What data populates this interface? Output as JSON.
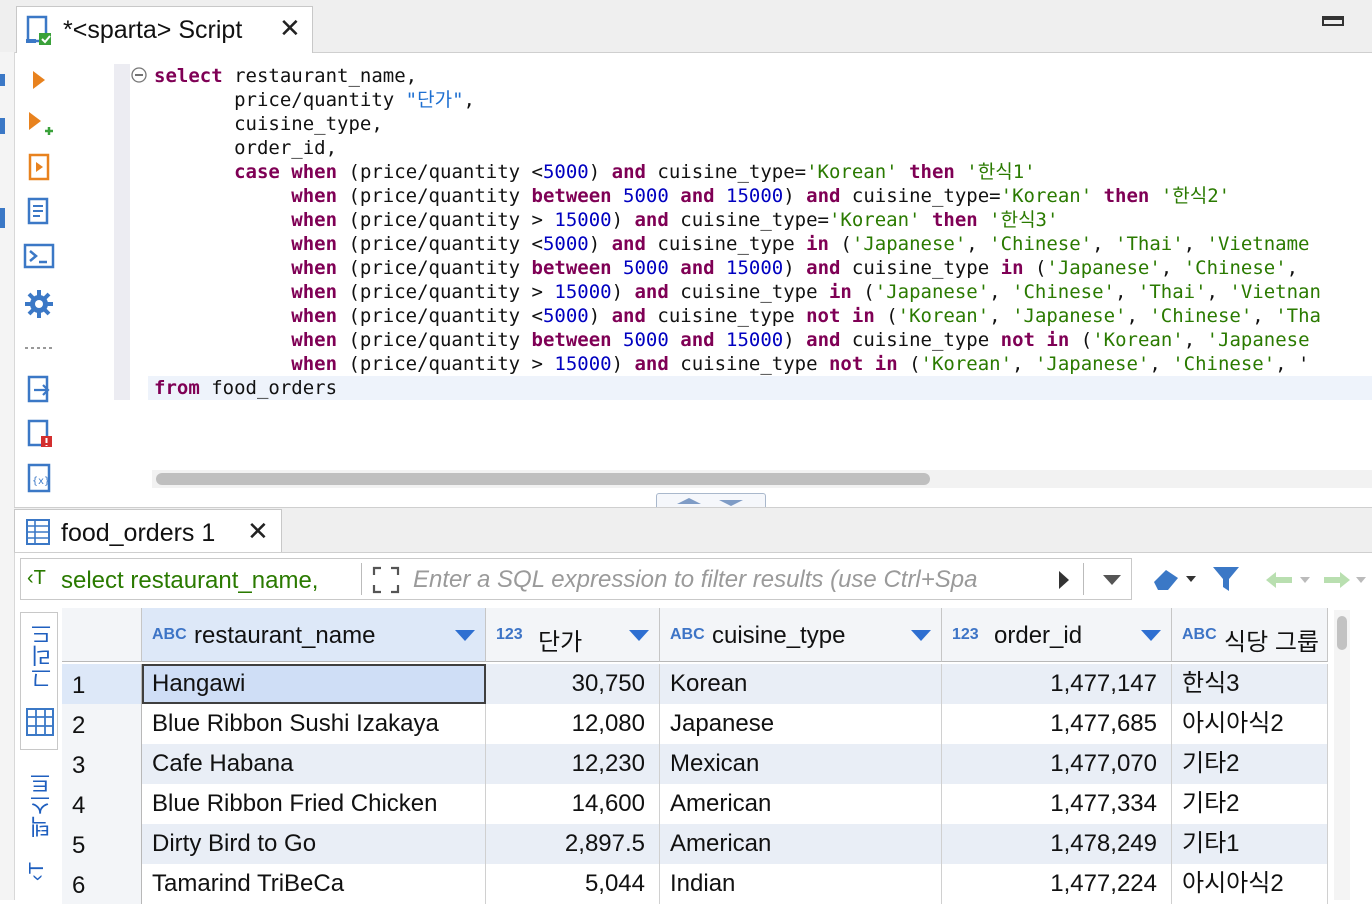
{
  "editor": {
    "tab_title": "*<sparta> Script",
    "code_lines": [
      [
        {
          "k": "kw",
          "t": "select"
        },
        {
          "k": "",
          "t": " restaurant_name,"
        }
      ],
      [
        {
          "k": "",
          "t": "       price/quantity "
        },
        {
          "k": "str2",
          "t": "\"단가\""
        },
        {
          "k": "",
          "t": ","
        }
      ],
      [
        {
          "k": "",
          "t": "       cuisine_type,"
        }
      ],
      [
        {
          "k": "",
          "t": "       order_id,"
        }
      ],
      [
        {
          "k": "",
          "t": "       "
        },
        {
          "k": "kw",
          "t": "case"
        },
        {
          "k": "",
          "t": " "
        },
        {
          "k": "kw",
          "t": "when"
        },
        {
          "k": "",
          "t": " (price/quantity <"
        },
        {
          "k": "num",
          "t": "5000"
        },
        {
          "k": "",
          "t": ") "
        },
        {
          "k": "kw",
          "t": "and"
        },
        {
          "k": "",
          "t": " cuisine_type="
        },
        {
          "k": "str",
          "t": "'Korean'"
        },
        {
          "k": "",
          "t": " "
        },
        {
          "k": "kw",
          "t": "then"
        },
        {
          "k": "",
          "t": " "
        },
        {
          "k": "str",
          "t": "'한식1'"
        }
      ],
      [
        {
          "k": "",
          "t": "            "
        },
        {
          "k": "kw",
          "t": "when"
        },
        {
          "k": "",
          "t": " (price/quantity "
        },
        {
          "k": "kw",
          "t": "between"
        },
        {
          "k": "",
          "t": " "
        },
        {
          "k": "num",
          "t": "5000"
        },
        {
          "k": "",
          "t": " "
        },
        {
          "k": "kw",
          "t": "and"
        },
        {
          "k": "",
          "t": " "
        },
        {
          "k": "num",
          "t": "15000"
        },
        {
          "k": "",
          "t": ") "
        },
        {
          "k": "kw",
          "t": "and"
        },
        {
          "k": "",
          "t": " cuisine_type="
        },
        {
          "k": "str",
          "t": "'Korean'"
        },
        {
          "k": "",
          "t": " "
        },
        {
          "k": "kw",
          "t": "then"
        },
        {
          "k": "",
          "t": " "
        },
        {
          "k": "str",
          "t": "'한식2'"
        }
      ],
      [
        {
          "k": "",
          "t": "            "
        },
        {
          "k": "kw",
          "t": "when"
        },
        {
          "k": "",
          "t": " (price/quantity > "
        },
        {
          "k": "num",
          "t": "15000"
        },
        {
          "k": "",
          "t": ") "
        },
        {
          "k": "kw",
          "t": "and"
        },
        {
          "k": "",
          "t": " cuisine_type="
        },
        {
          "k": "str",
          "t": "'Korean'"
        },
        {
          "k": "",
          "t": " "
        },
        {
          "k": "kw",
          "t": "then"
        },
        {
          "k": "",
          "t": " "
        },
        {
          "k": "str",
          "t": "'한식3'"
        }
      ],
      [
        {
          "k": "",
          "t": "            "
        },
        {
          "k": "kw",
          "t": "when"
        },
        {
          "k": "",
          "t": " (price/quantity <"
        },
        {
          "k": "num",
          "t": "5000"
        },
        {
          "k": "",
          "t": ") "
        },
        {
          "k": "kw",
          "t": "and"
        },
        {
          "k": "",
          "t": " cuisine_type "
        },
        {
          "k": "kw",
          "t": "in"
        },
        {
          "k": "",
          "t": " ("
        },
        {
          "k": "str",
          "t": "'Japanese'"
        },
        {
          "k": "",
          "t": ", "
        },
        {
          "k": "str",
          "t": "'Chinese'"
        },
        {
          "k": "",
          "t": ", "
        },
        {
          "k": "str",
          "t": "'Thai'"
        },
        {
          "k": "",
          "t": ", "
        },
        {
          "k": "str",
          "t": "'Vietname"
        }
      ],
      [
        {
          "k": "",
          "t": "            "
        },
        {
          "k": "kw",
          "t": "when"
        },
        {
          "k": "",
          "t": " (price/quantity "
        },
        {
          "k": "kw",
          "t": "between"
        },
        {
          "k": "",
          "t": " "
        },
        {
          "k": "num",
          "t": "5000"
        },
        {
          "k": "",
          "t": " "
        },
        {
          "k": "kw",
          "t": "and"
        },
        {
          "k": "",
          "t": " "
        },
        {
          "k": "num",
          "t": "15000"
        },
        {
          "k": "",
          "t": ") "
        },
        {
          "k": "kw",
          "t": "and"
        },
        {
          "k": "",
          "t": " cuisine_type "
        },
        {
          "k": "kw",
          "t": "in"
        },
        {
          "k": "",
          "t": " ("
        },
        {
          "k": "str",
          "t": "'Japanese'"
        },
        {
          "k": "",
          "t": ", "
        },
        {
          "k": "str",
          "t": "'Chinese'"
        },
        {
          "k": "",
          "t": ","
        }
      ],
      [
        {
          "k": "",
          "t": "            "
        },
        {
          "k": "kw",
          "t": "when"
        },
        {
          "k": "",
          "t": " (price/quantity > "
        },
        {
          "k": "num",
          "t": "15000"
        },
        {
          "k": "",
          "t": ") "
        },
        {
          "k": "kw",
          "t": "and"
        },
        {
          "k": "",
          "t": " cuisine_type "
        },
        {
          "k": "kw",
          "t": "in"
        },
        {
          "k": "",
          "t": " ("
        },
        {
          "k": "str",
          "t": "'Japanese'"
        },
        {
          "k": "",
          "t": ", "
        },
        {
          "k": "str",
          "t": "'Chinese'"
        },
        {
          "k": "",
          "t": ", "
        },
        {
          "k": "str",
          "t": "'Thai'"
        },
        {
          "k": "",
          "t": ", "
        },
        {
          "k": "str",
          "t": "'Vietnan"
        }
      ],
      [
        {
          "k": "",
          "t": "            "
        },
        {
          "k": "kw",
          "t": "when"
        },
        {
          "k": "",
          "t": " (price/quantity <"
        },
        {
          "k": "num",
          "t": "5000"
        },
        {
          "k": "",
          "t": ") "
        },
        {
          "k": "kw",
          "t": "and"
        },
        {
          "k": "",
          "t": " cuisine_type "
        },
        {
          "k": "kw",
          "t": "not"
        },
        {
          "k": "",
          "t": " "
        },
        {
          "k": "kw",
          "t": "in"
        },
        {
          "k": "",
          "t": " ("
        },
        {
          "k": "str",
          "t": "'Korean'"
        },
        {
          "k": "",
          "t": ", "
        },
        {
          "k": "str",
          "t": "'Japanese'"
        },
        {
          "k": "",
          "t": ", "
        },
        {
          "k": "str",
          "t": "'Chinese'"
        },
        {
          "k": "",
          "t": ", "
        },
        {
          "k": "str",
          "t": "'Tha"
        }
      ],
      [
        {
          "k": "",
          "t": "            "
        },
        {
          "k": "kw",
          "t": "when"
        },
        {
          "k": "",
          "t": " (price/quantity "
        },
        {
          "k": "kw",
          "t": "between"
        },
        {
          "k": "",
          "t": " "
        },
        {
          "k": "num",
          "t": "5000"
        },
        {
          "k": "",
          "t": " "
        },
        {
          "k": "kw",
          "t": "and"
        },
        {
          "k": "",
          "t": " "
        },
        {
          "k": "num",
          "t": "15000"
        },
        {
          "k": "",
          "t": ") "
        },
        {
          "k": "kw",
          "t": "and"
        },
        {
          "k": "",
          "t": " cuisine_type "
        },
        {
          "k": "kw",
          "t": "not"
        },
        {
          "k": "",
          "t": " "
        },
        {
          "k": "kw",
          "t": "in"
        },
        {
          "k": "",
          "t": " ("
        },
        {
          "k": "str",
          "t": "'Korean'"
        },
        {
          "k": "",
          "t": ", "
        },
        {
          "k": "str",
          "t": "'Japanese"
        }
      ],
      [
        {
          "k": "",
          "t": "            "
        },
        {
          "k": "kw",
          "t": "when"
        },
        {
          "k": "",
          "t": " (price/quantity > "
        },
        {
          "k": "num",
          "t": "15000"
        },
        {
          "k": "",
          "t": ") "
        },
        {
          "k": "kw",
          "t": "and"
        },
        {
          "k": "",
          "t": " cuisine_type "
        },
        {
          "k": "kw",
          "t": "not"
        },
        {
          "k": "",
          "t": " "
        },
        {
          "k": "kw",
          "t": "in"
        },
        {
          "k": "",
          "t": " ("
        },
        {
          "k": "str",
          "t": "'Korean'"
        },
        {
          "k": "",
          "t": ", "
        },
        {
          "k": "str",
          "t": "'Japanese'"
        },
        {
          "k": "",
          "t": ", "
        },
        {
          "k": "str",
          "t": "'Chinese'"
        },
        {
          "k": "",
          "t": ", '"
        }
      ],
      [
        {
          "k": "kw",
          "t": "from"
        },
        {
          "k": "",
          "t": " food_orders"
        }
      ]
    ]
  },
  "results": {
    "tab_title": "food_orders 1",
    "filter_query": "select restaurant_name,",
    "filter_placeholder": "Enter a SQL expression to filter results (use Ctrl+Spa",
    "side_tabs": {
      "grid": "그리드",
      "text": "텍스트"
    },
    "columns": [
      {
        "type": "ABC",
        "name": "restaurant_name"
      },
      {
        "type": "123",
        "name": "단가"
      },
      {
        "type": "ABC",
        "name": "cuisine_type"
      },
      {
        "type": "123",
        "name": "order_id"
      },
      {
        "type": "ABC",
        "name": "식당 그룹"
      }
    ],
    "rows": [
      [
        "1",
        "Hangawi",
        "30,750",
        "Korean",
        "1,477,147",
        "한식3"
      ],
      [
        "2",
        "Blue Ribbon Sushi Izakaya",
        "12,080",
        "Japanese",
        "1,477,685",
        "아시아식2"
      ],
      [
        "3",
        "Cafe Habana",
        "12,230",
        "Mexican",
        "1,477,070",
        "기타2"
      ],
      [
        "4",
        "Blue Ribbon Fried Chicken",
        "14,600",
        "American",
        "1,477,334",
        "기타2"
      ],
      [
        "5",
        "Dirty Bird to Go",
        "2,897.5",
        "American",
        "1,478,249",
        "기타1"
      ],
      [
        "6",
        "Tamarind TriBeCa",
        "5,044",
        "Indian",
        "1,477,224",
        "아시아식2"
      ]
    ]
  }
}
